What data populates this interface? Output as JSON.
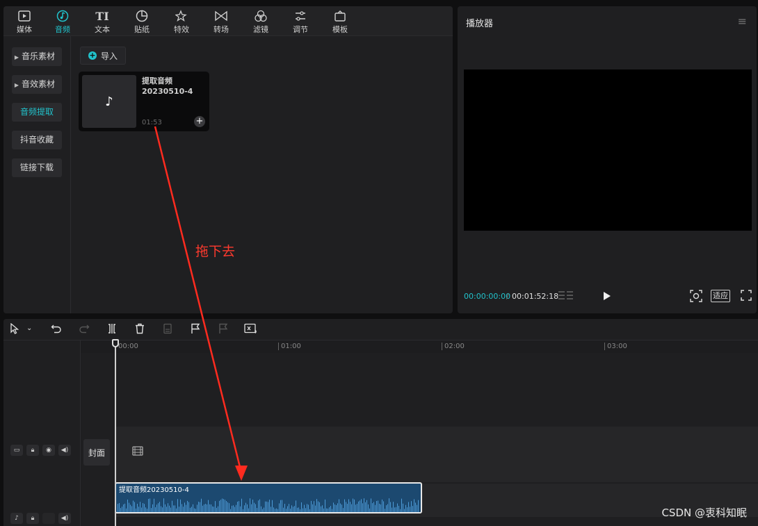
{
  "tabs": [
    {
      "label": "媒体",
      "icon": "media-icon"
    },
    {
      "label": "音频",
      "icon": "audio-icon",
      "active": true
    },
    {
      "label": "文本",
      "icon": "text-icon"
    },
    {
      "label": "贴纸",
      "icon": "sticker-icon"
    },
    {
      "label": "特效",
      "icon": "effects-icon"
    },
    {
      "label": "转场",
      "icon": "transition-icon"
    },
    {
      "label": "滤镜",
      "icon": "filter-icon"
    },
    {
      "label": "调节",
      "icon": "adjust-icon"
    },
    {
      "label": "模板",
      "icon": "template-icon"
    }
  ],
  "sidebar": {
    "items": [
      {
        "label": "音乐素材",
        "expandable": true
      },
      {
        "label": "音效素材",
        "expandable": true
      },
      {
        "label": "音频提取",
        "active": true
      },
      {
        "label": "抖音收藏"
      },
      {
        "label": "链接下载"
      }
    ]
  },
  "library": {
    "import_label": "导入",
    "card": {
      "title_line1": "提取音频",
      "title_line2": "20230510-4",
      "duration": "01:53"
    }
  },
  "player": {
    "title": "播放器",
    "current_time": "00:00:00:00",
    "separator": "/",
    "total_time": "00:01:52:18",
    "fit_label": "适应"
  },
  "timeline": {
    "ruler_ticks": [
      "00:00",
      "01:00",
      "02:00",
      "03:00"
    ],
    "cover_label": "封面",
    "clip_label": "提取音频20230510-4"
  },
  "annotation": {
    "text": "拖下去",
    "color": "#ff3a2e"
  },
  "watermark": "CSDN @衷科知眠",
  "colors": {
    "accent": "#21c3cc",
    "clip": "#1c4970"
  }
}
